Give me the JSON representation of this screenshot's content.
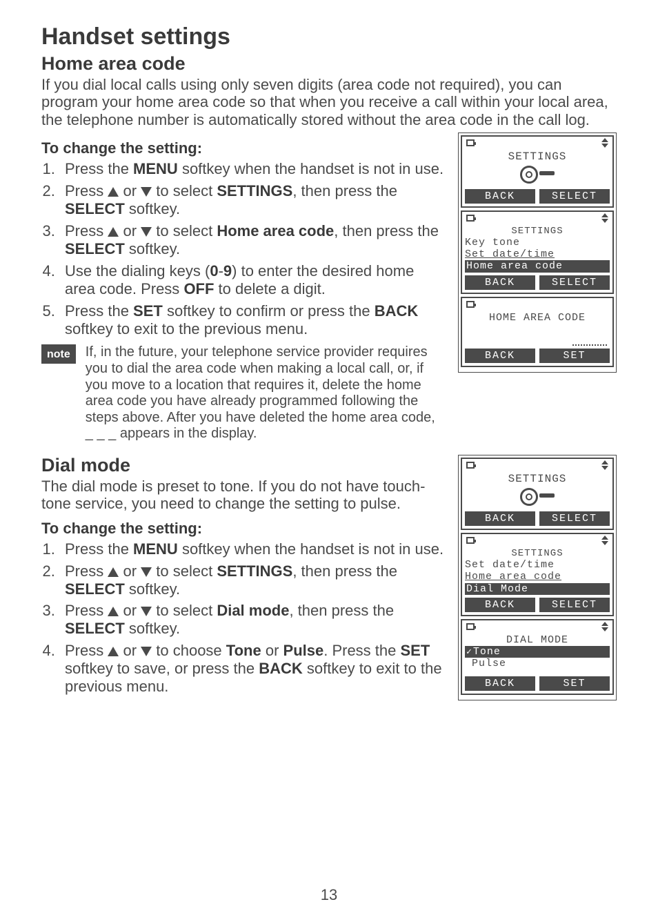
{
  "page_number": "13",
  "h1": "Handset settings",
  "section1": {
    "h2": "Home area code",
    "intro": "If you dial local calls using only seven digits (area code not required), you can program your home area code so that when you receive a call within your local area, the telephone number is automatically stored without the area code in the call log.",
    "h3": "To change the setting:",
    "steps": {
      "s1a": "Press the ",
      "s1b": "MENU",
      "s1c": " softkey when the handset is not in use.",
      "s2a": "Press ",
      "s2b": " or ",
      "s2c": " to select ",
      "s2d": "SETTINGS",
      "s2e": ", then press the ",
      "s2f": "SELECT",
      "s2g": " softkey.",
      "s3a": "Press ",
      "s3b": " or ",
      "s3c": " to select ",
      "s3d": "Home area code",
      "s3e": ", then press the ",
      "s3f": "SELECT",
      "s3g": " softkey.",
      "s4a": "Use the dialing keys (",
      "s4b": "0",
      "s4c": "-",
      "s4d": "9",
      "s4e": ") to enter the desired home area code. Press ",
      "s4f": "OFF",
      "s4g": " to delete a digit.",
      "s5a": "Press the ",
      "s5b": "SET",
      "s5c": " softkey to confirm or press the ",
      "s5d": "BACK",
      "s5e": " softkey to exit to the previous menu."
    },
    "note_label": "note",
    "note_text": "If, in the future, your telephone service provider requires you to dial the area code when making a local call, or, if you move to a location that requires it, delete the home area code you have already programmed following the steps above. After you have deleted the home area code, _ _ _ appears in the display."
  },
  "section2": {
    "h2": "Dial mode",
    "intro": "The dial mode is preset to tone. If you do not have touch-tone service, you need to change the setting to pulse.",
    "h3": "To change the setting:",
    "steps": {
      "s1a": "Press the ",
      "s1b": "MENU",
      "s1c": " softkey when the handset is not in use.",
      "s2a": "Press ",
      "s2b": " or ",
      "s2c": " to select ",
      "s2d": "SETTINGS",
      "s2e": ", then press the ",
      "s2f": "SELECT",
      "s2g": " softkey.",
      "s3a": "Press ",
      "s3b": " or ",
      "s3c": " to select ",
      "s3d": "Dial mode",
      "s3e": ", then press the ",
      "s3f": "SELECT",
      "s3g": " softkey.",
      "s4a": "Press ",
      "s4b": " or ",
      "s4c": " to choose ",
      "s4d": "Tone",
      "s4e": " or ",
      "s4f": "Pulse",
      "s4g": ". Press the ",
      "s4h": "SET",
      "s4i": " softkey to save, or press the ",
      "s4j": "BACK",
      "s4k": " softkey to exit to the previous menu."
    }
  },
  "lcd": {
    "settings_title": "SETTINGS",
    "back": "BACK",
    "select": "SELECT",
    "set": "SET",
    "hac": {
      "row1": "Key tone",
      "row2": "Set date/time",
      "row3": "Home area code",
      "entry_title": "HOME AREA CODE"
    },
    "dm": {
      "row1": "Set date/time",
      "row2": "Home area code",
      "row3": "Dial Mode",
      "entry_title": "DIAL MODE",
      "opt1": "Tone",
      "opt2": "Pulse"
    }
  }
}
